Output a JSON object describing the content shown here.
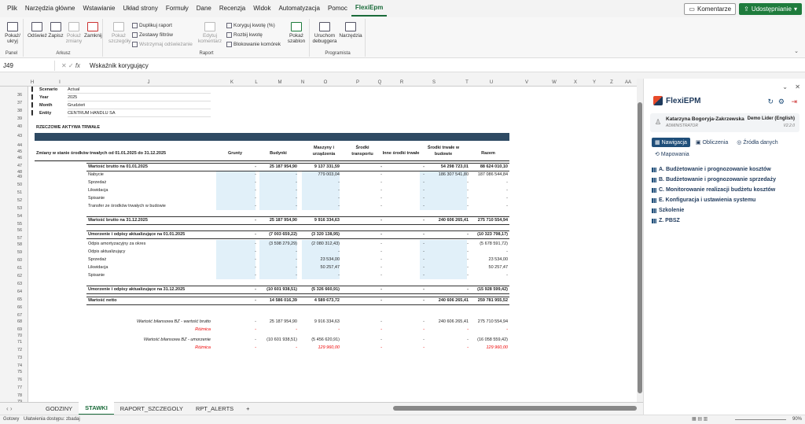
{
  "menu": {
    "items": [
      "Plik",
      "Narzędzia główne",
      "Wstawianie",
      "Układ strony",
      "Formuły",
      "Dane",
      "Recenzja",
      "Widok",
      "Automatyzacja",
      "Pomoc",
      "FlexiEpm"
    ],
    "active": "FlexiEpm",
    "comments_label": "Komentarze",
    "share_label": "Udostępnianie"
  },
  "ribbon": {
    "panel_btn": "Pokaż/ ukryj",
    "panel_group": "Panel",
    "arkusz": {
      "odswiez": "Odśwież",
      "zapisz": "Zapisz",
      "pokaz_zmiany": "Pokaż zmiany",
      "zamknij": "Zamknij",
      "group": "Arkusz"
    },
    "raport": {
      "pokaz_szczegoly": "Pokaż szczegóły",
      "duplikuj": "Duplikuj raport",
      "zestawy": "Zestawy filtrów",
      "wstrzymaj": "Wstrzymaj odświeżanie",
      "edytuj": "Edytuj komentarz",
      "koryguj": "Koryguj kwotę (%)",
      "rozbij": "Rozbij kwotę",
      "blokowanie": "Blokowanie komórek",
      "szablon": "Pokaż szablon",
      "group": "Raport"
    },
    "programista": {
      "debugger": "Uruchom debuggera",
      "narzedzia": "Narzędzia",
      "group": "Programista"
    }
  },
  "formula": {
    "namebox": "J49",
    "fx": "fx",
    "text": "Wskaźnik korygujący"
  },
  "columns": [
    "H",
    "I",
    "J",
    "K",
    "L",
    "M",
    "N",
    "O",
    "P",
    "Q",
    "R",
    "S",
    "T",
    "U",
    "V",
    "W",
    "X",
    "Y",
    "Z",
    "AA"
  ],
  "rows": [
    "36",
    "37",
    "38",
    "39",
    "40",
    "43",
    "44",
    "45",
    "46",
    "47",
    "48",
    "49",
    "50",
    "51",
    "52",
    "53",
    "54",
    "55",
    "56",
    "57",
    "58",
    "59",
    "60",
    "61",
    "62",
    "63",
    "64",
    "65",
    "66",
    "67",
    "68",
    "69",
    "70",
    "71",
    "72",
    "73",
    "74",
    "75",
    "76",
    "77",
    "78",
    "79",
    "80",
    "81",
    "82",
    "83",
    "84"
  ],
  "params": [
    {
      "label": "Scenario",
      "value": "Actual"
    },
    {
      "label": "Year",
      "value": "2025"
    },
    {
      "label": "Month",
      "value": "Grudzień"
    },
    {
      "label": "Entity",
      "value": "CENTRUM HANDLU SA"
    }
  ],
  "section_title": "RZECZOWE AKTYWA TRWAŁE",
  "table": {
    "caption": "Zmiany w stanie środków trwałych od 01.01.2025 do 31.12.2025",
    "headers": [
      "Grunty",
      "Budynki",
      "Maszyny i urządzenia",
      "Środki transportu",
      "Inne środki trwałe",
      "Środki trwałe w budowie",
      "Razem"
    ],
    "rows": [
      {
        "label": "Wartość brutto na 01.01.2025",
        "bold": true,
        "vals": [
          "-",
          "25 187 954,90",
          "9 137 331,59",
          "-",
          "-",
          "54 298 723,01",
          "88 624 010,10"
        ]
      },
      {
        "label": "Nabycie",
        "vals": [
          "-",
          "-",
          "779 003,04",
          "-",
          "-",
          "186 307 541,80",
          "187 086 544,84"
        ]
      },
      {
        "label": "Sprzedaż",
        "vals": [
          "-",
          "-",
          "-",
          "-",
          "-",
          "-",
          "-"
        ]
      },
      {
        "label": "Likwidacja",
        "vals": [
          "-",
          "-",
          "-",
          "-",
          "-",
          "-",
          "-"
        ]
      },
      {
        "label": "Spisanie",
        "vals": [
          "-",
          "-",
          "-",
          "-",
          "-",
          "-",
          "-"
        ]
      },
      {
        "label": "Transfer ze środków trwałych w budowie",
        "vals": [
          "-",
          "-",
          "-",
          "-",
          "-",
          "-",
          "-"
        ]
      },
      {
        "label": "Wartość brutto na 31.12.2025",
        "bold": true,
        "vals": [
          "-",
          "25 187 954,90",
          "9 916 334,63",
          "-",
          "-",
          "240 606 265,41",
          "275 710 554,94"
        ]
      },
      {
        "label": "Umorzenie i odpisy aktualizujące na 01.01.2025",
        "bold": true,
        "vals": [
          "-",
          "(7 003 659,22)",
          "(3 320 138,95)",
          "-",
          "-",
          "-",
          "(10 323 798,17)"
        ]
      },
      {
        "label": "Odpis amortyzacyjny za okres",
        "vals": [
          "-",
          "(3 598 279,29)",
          "(2 080 312,43)",
          "-",
          "-",
          "-",
          "(5 678 591,72)"
        ]
      },
      {
        "label": "Odpis aktualizujący",
        "vals": [
          "-",
          "-",
          "-",
          "-",
          "-",
          "-",
          "-"
        ]
      },
      {
        "label": "Sprzedaż",
        "vals": [
          "-",
          "-",
          "23 534,00",
          "-",
          "-",
          "-",
          "23 534,00"
        ]
      },
      {
        "label": "Likwidacja",
        "vals": [
          "-",
          "-",
          "50 257,47",
          "-",
          "-",
          "-",
          "50 257,47"
        ]
      },
      {
        "label": "Spisanie",
        "vals": [
          "-",
          "-",
          "-",
          "-",
          "-",
          "-",
          "-"
        ]
      },
      {
        "label": "Umorzenie i odpisy aktualizujące na 31.12.2025",
        "bold": true,
        "vals": [
          "-",
          "(10 601 938,51)",
          "(5 326 660,91)",
          "-",
          "-",
          "-",
          "(15 928 599,42)"
        ]
      },
      {
        "label": "Wartość netto",
        "bold": true,
        "vals": [
          "-",
          "14 586 016,39",
          "4 589 673,72",
          "-",
          "-",
          "240 606 265,41",
          "259 781 955,52"
        ]
      }
    ],
    "checks": [
      {
        "label": "Wartość bilansowa BZ - wartość brutto",
        "vals": [
          "-",
          "25 187 954,90",
          "9 916 334,63",
          "-",
          "-",
          "240 606 265,41",
          "275 710 554,94"
        ]
      },
      {
        "label": "Różnica",
        "red": true,
        "vals": [
          "-",
          "-",
          "-",
          "-",
          "-",
          "-",
          "-"
        ]
      },
      {
        "label": "Wartość bilansowa BZ - umorzenie",
        "vals": [
          "-",
          "(10 601 938,51)",
          "(5 456 620,91)",
          "-",
          "-",
          "-",
          "(16 058 559,42)"
        ]
      },
      {
        "label": "Różnica",
        "red": true,
        "vals": [
          "-",
          "-",
          "129 960,00",
          "-",
          "-",
          "-",
          "129 960,00"
        ]
      }
    ]
  },
  "tabs": [
    "GODZINY",
    "STAWKI",
    "RAPORT_SZCZEGOLY",
    "RPT_ALERTS"
  ],
  "active_tab": "STAWKI",
  "status": {
    "ready": "Gotowy",
    "accessibility": "Ułatwienia dostępu: zbadaj",
    "zoom": "90%"
  },
  "panel": {
    "logo": "FlexiEPM",
    "user_name": "Katarzyna Bogoryja-Zakrzewska",
    "user_role": "ADMINISTRATOR",
    "company": "Demo Lider (English)",
    "version": "V2.2.0",
    "tabs": [
      "Nawigacja",
      "Obliczenia",
      "Źródła danych",
      "Mapowania"
    ],
    "nav": [
      "A. Budżetowanie i prognozowanie kosztów",
      "B. Budżetowanie i prognozowanie sprzedaży",
      "C. Monitorowanie realizacji budżetu kosztów",
      "E. Konfiguracja i ustawienia systemu",
      "Szkolenie",
      "Z. PBSZ"
    ]
  }
}
